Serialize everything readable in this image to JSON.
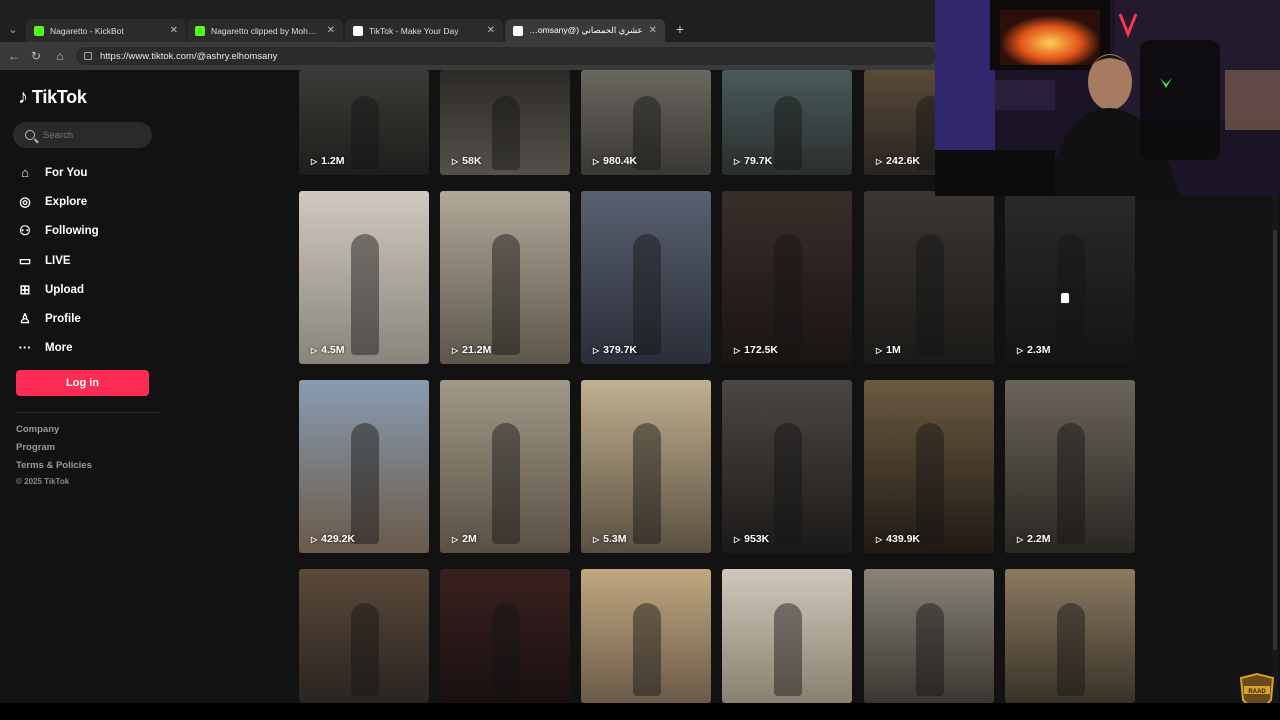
{
  "browser": {
    "tabs": [
      {
        "title": "Nagaretto - KickBot",
        "favicon_color": "#53fc18",
        "active": false
      },
      {
        "title": "Nagaretto clipped by Mohamad_S",
        "favicon_color": "#53fc18",
        "active": false
      },
      {
        "title": "TikTok - Make Your Day",
        "favicon_color": "#ffffff",
        "active": false
      },
      {
        "title": "عشري الحمصاني (@ashry.elhomsany",
        "favicon_color": "#ffffff",
        "active": true
      }
    ],
    "new_tab_label": "+",
    "url": "https://www.tiktok.com/@ashry.elhomsany"
  },
  "sidebar": {
    "logo_text": "TikTok",
    "search_placeholder": "Search",
    "nav": [
      {
        "label": "For You",
        "icon": "home-icon"
      },
      {
        "label": "Explore",
        "icon": "compass-icon"
      },
      {
        "label": "Following",
        "icon": "following-icon"
      },
      {
        "label": "LIVE",
        "icon": "live-icon"
      },
      {
        "label": "Upload",
        "icon": "upload-icon"
      },
      {
        "label": "Profile",
        "icon": "profile-icon"
      },
      {
        "label": "More",
        "icon": "more-icon"
      }
    ],
    "login_label": "Log in",
    "footer_links": [
      "Company",
      "Program",
      "Terms & Policies"
    ],
    "copyright": "© 2025 TikTok"
  },
  "videos": [
    {
      "views": "1.2M"
    },
    {
      "views": "58K"
    },
    {
      "views": "980.4K"
    },
    {
      "views": "79.7K"
    },
    {
      "views": "242.6K"
    },
    {
      "views": ""
    },
    {
      "views": "4.5M"
    },
    {
      "views": "21.2M"
    },
    {
      "views": "379.7K"
    },
    {
      "views": "172.5K"
    },
    {
      "views": "1M"
    },
    {
      "views": "2.3M"
    },
    {
      "views": "429.2K"
    },
    {
      "views": "2M"
    },
    {
      "views": "5.3M"
    },
    {
      "views": "953K"
    },
    {
      "views": "439.9K"
    },
    {
      "views": "2.2M"
    },
    {
      "views": ""
    },
    {
      "views": ""
    },
    {
      "views": ""
    },
    {
      "views": ""
    },
    {
      "views": ""
    },
    {
      "views": ""
    }
  ],
  "colors": {
    "brand_accent": "#fe2c55",
    "background": "#121212"
  }
}
